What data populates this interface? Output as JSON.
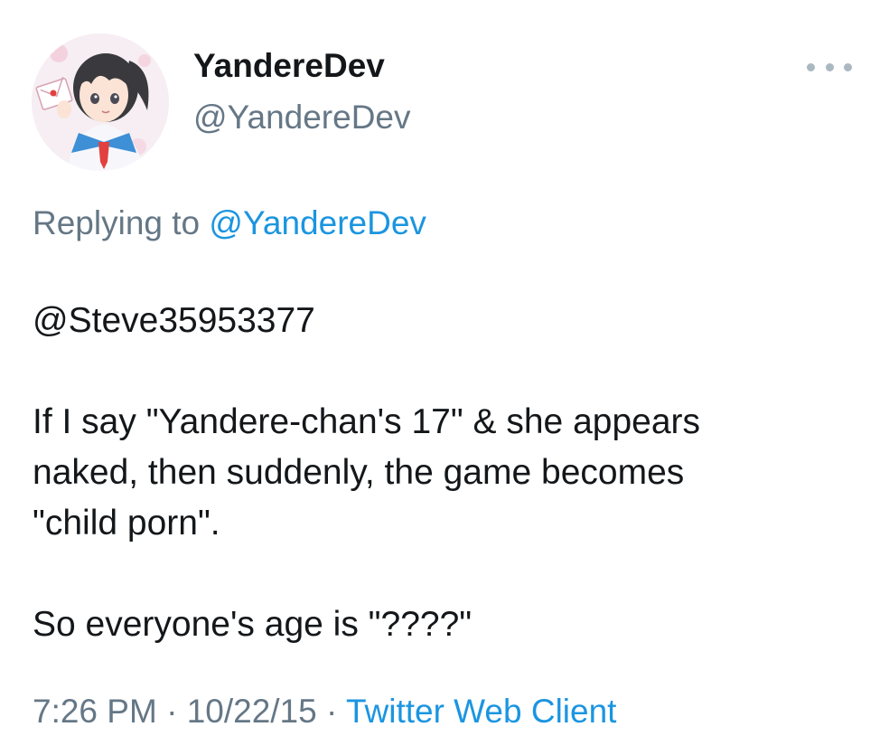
{
  "author": {
    "display_name": "YandereDev",
    "handle": "@YandereDev",
    "avatar_icon": "anime-girl-avatar"
  },
  "menu": {
    "icon": "more-options-icon"
  },
  "reply": {
    "prefix": "Replying to ",
    "mention": "@YandereDev"
  },
  "body": {
    "line1": "@Steve35953377",
    "para2": "If I say \"Yandere-chan's 17\" & she appears\nnaked, then suddenly, the game becomes\n\"child porn\".",
    "para3": "So everyone's age is \"????\""
  },
  "meta": {
    "time": "7:26 PM",
    "sep1": " · ",
    "date": "10/22/15",
    "sep2": " · ",
    "client": "Twitter Web Client"
  },
  "colors": {
    "text": "#14171a",
    "secondary": "#657786",
    "link": "#1b95e0"
  }
}
